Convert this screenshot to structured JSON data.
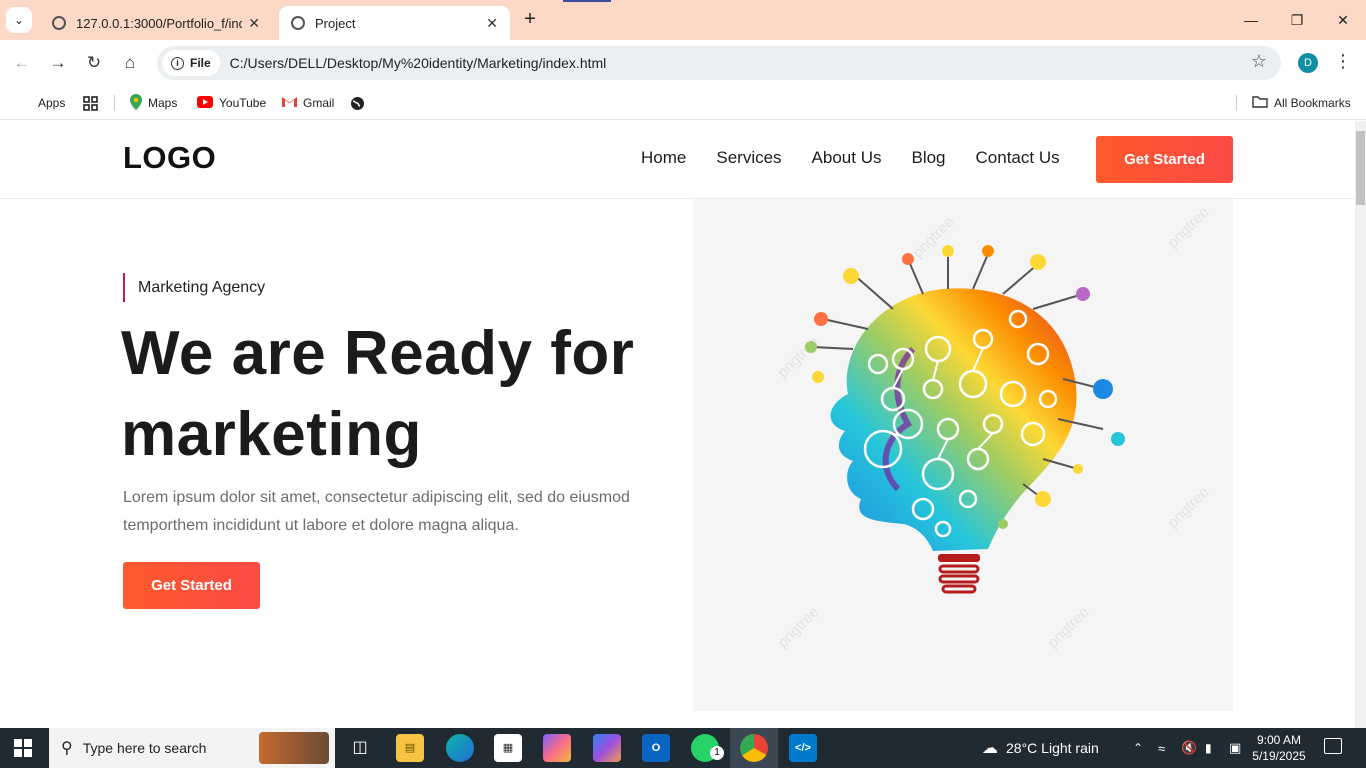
{
  "browser": {
    "tabs": [
      {
        "title": "127.0.0.1:3000/Portfolio_f/index",
        "active": false
      },
      {
        "title": "Project",
        "active": true
      }
    ],
    "file_chip": "File",
    "url": "C:/Users/DELL/Desktop/My%20identity/Marketing/index.html",
    "profile_initial": "D",
    "bookmarks": {
      "apps": "Apps",
      "maps": "Maps",
      "youtube": "YouTube",
      "gmail": "Gmail",
      "all": "All Bookmarks"
    }
  },
  "site": {
    "logo": "LOGO",
    "nav": [
      "Home",
      "Services",
      "About Us",
      "Blog",
      "Contact Us"
    ],
    "header_cta": "Get Started",
    "eyebrow": "Marketing Agency",
    "hero_title": "We are Ready for marketing",
    "hero_text": "Lorem ipsum dolor sit amet, consectetur adipiscing elit, sed do eiusmod temporthem incididunt ut labore et dolore magna aliqua.",
    "hero_cta": "Get Started",
    "image_watermark": "pngtree",
    "accent_color": "#fe5a2c",
    "eyebrow_bar_color": "#c2185b"
  },
  "taskbar": {
    "search_placeholder": "Type here to search",
    "weather": "28°C  Light rain",
    "time": "9:00 AM",
    "date": "5/19/2025",
    "whatsapp_badge": "1"
  }
}
